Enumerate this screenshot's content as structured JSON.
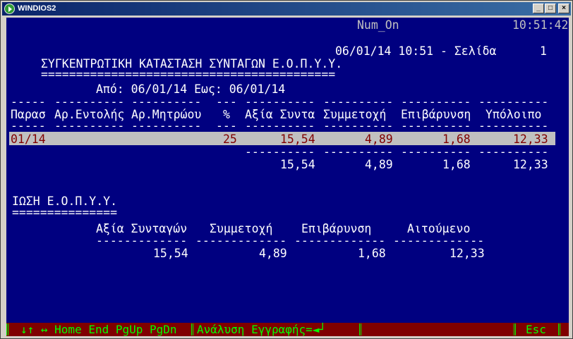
{
  "window": {
    "title": "WINDIOS2",
    "minimize_label": "_",
    "maximize_label": "□",
    "close_label": "×"
  },
  "topbar": {
    "mode": "Num_On",
    "clock": "10:51:42"
  },
  "report": {
    "header_line": "06/01/14 10:51 - Σελίδα",
    "page_number": "1",
    "title": "ΣΥΓΚΕΝΤΡΩΤΙΚΗ ΚΑΤΑΣΤΑΣΗ ΣΥΝΤΑΓΩΝ Ε.Ο.Π.Υ.Υ.",
    "title_rule": "==========================================",
    "range": "Από: 06/01/14 Εως: 06/01/14",
    "columns": [
      {
        "label": "Παρασ",
        "rule": "-----"
      },
      {
        "label": "Αρ.Εντολής",
        "rule": "----------"
      },
      {
        "label": "Αρ.Μητρώου",
        "rule": "----------"
      },
      {
        "label": "%",
        "rule": "---"
      },
      {
        "label": "Αξία Συντα",
        "rule": "----------"
      },
      {
        "label": "Συμμετοχή",
        "rule": "----------"
      },
      {
        "label": "Επιβάρυνση",
        "rule": "----------"
      },
      {
        "label": "Υπόλοιπο",
        "rule": "----------"
      }
    ],
    "row": {
      "paras": "01/14",
      "entoli": "",
      "mitroo": "",
      "pososto": "25",
      "axia": "15,54",
      "symmetoxi": "4,89",
      "epivarynsi": "1,68",
      "ypoloipo": "12,33"
    },
    "total_rule": "----------",
    "totals": {
      "axia": "15,54",
      "symmetoxi": "4,89",
      "epivarynsi": "1,68",
      "ypoloipo": "12,33"
    }
  },
  "summary": {
    "title": "ΙΩΣΗ Ε.Ο.Π.Υ.Υ.",
    "title_rule": "===============",
    "headers": [
      "Αξία Συνταγών",
      "Συμμετοχή",
      "Επιβάρυνση",
      "Αιτούμενο"
    ],
    "rule": "-------------",
    "values": [
      "15,54",
      "4,89",
      "1,68",
      "12,33"
    ]
  },
  "statusbar": {
    "nav": "↓↑ ↔ Home End PgUp PgDn",
    "action": "Ανάλυση Εγγραφής=◄┘",
    "esc": "Esc"
  }
}
